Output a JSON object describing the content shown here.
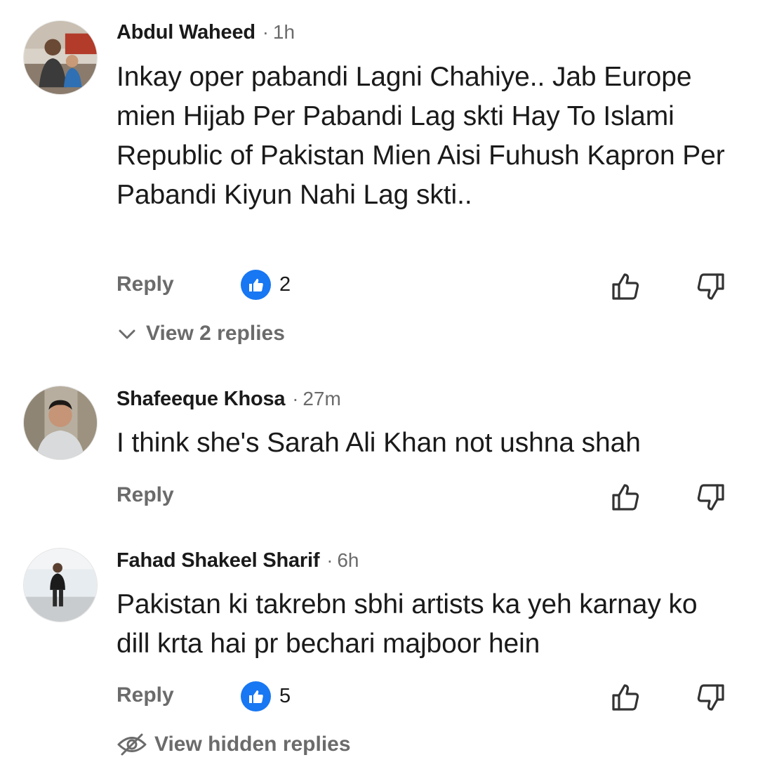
{
  "comments": [
    {
      "author": "Abdul Waheed",
      "separator": "·",
      "time": "1h",
      "text": "Inkay oper pabandi Lagni Chahiye.. Jab Europe mien Hijab Per Pabandi Lag skti Hay To Islami Republic of Pakistan Mien Aisi Fuhush Kapron Per Pabandi Kiyun Nahi Lag skti..",
      "reply_label": "Reply",
      "like_count": "2",
      "more_label": "View 2 replies"
    },
    {
      "author": "Shafeeque Khosa",
      "separator": "·",
      "time": "27m",
      "text": "I think she's Sarah Ali Khan not ushna shah",
      "reply_label": "Reply"
    },
    {
      "author": "Fahad Shakeel Sharif",
      "separator": "·",
      "time": "6h",
      "text": "Pakistan ki takrebn sbhi artists ka yeh karnay ko dill krta hai pr bechari majboor hein",
      "reply_label": "Reply",
      "like_count": "5",
      "more_label": "View hidden replies"
    }
  ],
  "icons": {
    "like_badge": "like-icon",
    "thumb_up": "thumbs-up-icon",
    "thumb_down": "thumbs-down-icon",
    "chevron": "chevron-down-icon",
    "hidden": "eye-off-icon"
  },
  "colors": {
    "like_badge": "#1877f2",
    "muted_text": "#6b6b6b",
    "text": "#1a1a1a"
  }
}
